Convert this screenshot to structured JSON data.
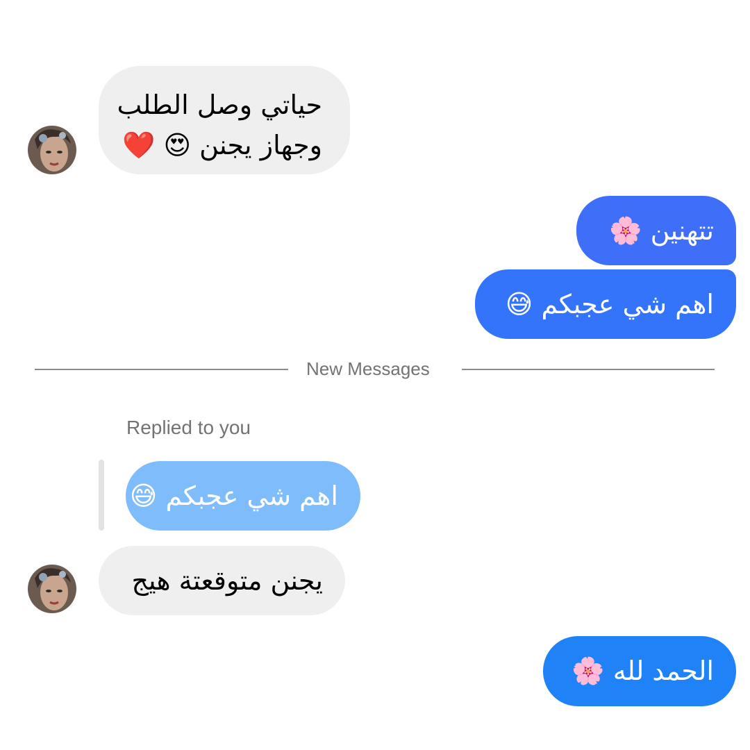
{
  "messages": [
    {
      "direction": "incoming",
      "lines": [
        "حياتي وصل الطلب",
        "وجهاز يجنن 😍 ❤️"
      ],
      "avatar": "user-avatar"
    },
    {
      "direction": "outgoing",
      "text": "تتهنين 🌸",
      "color": "#3f6ef8"
    },
    {
      "direction": "outgoing",
      "text": "اهم شي عجبكم 😅",
      "color": "#3474fa"
    },
    {
      "direction": "incoming",
      "reply_label": "Replied to you",
      "quoted_text": "اهم شي عجبكم 😅",
      "quoted_color": "#7fbcfb",
      "text": "يجنن متوقعتة هيج",
      "avatar": "user-avatar"
    },
    {
      "direction": "outgoing",
      "text": "الحمد لله 🌸",
      "color": "#1f82f7"
    }
  ],
  "divider": {
    "label": "New Messages"
  },
  "colors": {
    "incoming_bubble": "#efefef",
    "divider_line": "#8a8a8a",
    "muted_text": "#737373"
  }
}
